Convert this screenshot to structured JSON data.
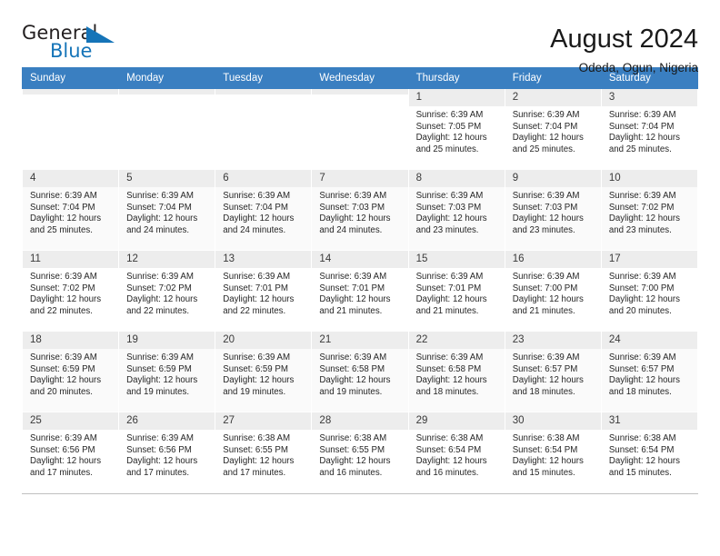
{
  "brand": {
    "name_top": "General",
    "name_bottom": "Blue",
    "accent_color": "#1574b8"
  },
  "header": {
    "title": "August 2024",
    "subtitle": "Odeda, Ogun, Nigeria"
  },
  "theme": {
    "header_bg": "#3a7fc1",
    "header_text": "#ffffff",
    "daynum_bg": "#ededed",
    "row_shade": "#fafafa"
  },
  "weekdays": [
    "Sunday",
    "Monday",
    "Tuesday",
    "Wednesday",
    "Thursday",
    "Friday",
    "Saturday"
  ],
  "labels": {
    "sunrise_prefix": "Sunrise:",
    "sunset_prefix": "Sunset:",
    "daylight_prefix": "Daylight:"
  },
  "weeks": [
    [
      {
        "day": "",
        "lines": []
      },
      {
        "day": "",
        "lines": []
      },
      {
        "day": "",
        "lines": []
      },
      {
        "day": "",
        "lines": []
      },
      {
        "day": "1",
        "lines": [
          "Sunrise: 6:39 AM",
          "Sunset: 7:05 PM",
          "Daylight: 12 hours",
          "and 25 minutes."
        ]
      },
      {
        "day": "2",
        "lines": [
          "Sunrise: 6:39 AM",
          "Sunset: 7:04 PM",
          "Daylight: 12 hours",
          "and 25 minutes."
        ]
      },
      {
        "day": "3",
        "lines": [
          "Sunrise: 6:39 AM",
          "Sunset: 7:04 PM",
          "Daylight: 12 hours",
          "and 25 minutes."
        ]
      }
    ],
    [
      {
        "day": "4",
        "lines": [
          "Sunrise: 6:39 AM",
          "Sunset: 7:04 PM",
          "Daylight: 12 hours",
          "and 25 minutes."
        ]
      },
      {
        "day": "5",
        "lines": [
          "Sunrise: 6:39 AM",
          "Sunset: 7:04 PM",
          "Daylight: 12 hours",
          "and 24 minutes."
        ]
      },
      {
        "day": "6",
        "lines": [
          "Sunrise: 6:39 AM",
          "Sunset: 7:04 PM",
          "Daylight: 12 hours",
          "and 24 minutes."
        ]
      },
      {
        "day": "7",
        "lines": [
          "Sunrise: 6:39 AM",
          "Sunset: 7:03 PM",
          "Daylight: 12 hours",
          "and 24 minutes."
        ]
      },
      {
        "day": "8",
        "lines": [
          "Sunrise: 6:39 AM",
          "Sunset: 7:03 PM",
          "Daylight: 12 hours",
          "and 23 minutes."
        ]
      },
      {
        "day": "9",
        "lines": [
          "Sunrise: 6:39 AM",
          "Sunset: 7:03 PM",
          "Daylight: 12 hours",
          "and 23 minutes."
        ]
      },
      {
        "day": "10",
        "lines": [
          "Sunrise: 6:39 AM",
          "Sunset: 7:02 PM",
          "Daylight: 12 hours",
          "and 23 minutes."
        ]
      }
    ],
    [
      {
        "day": "11",
        "lines": [
          "Sunrise: 6:39 AM",
          "Sunset: 7:02 PM",
          "Daylight: 12 hours",
          "and 22 minutes."
        ]
      },
      {
        "day": "12",
        "lines": [
          "Sunrise: 6:39 AM",
          "Sunset: 7:02 PM",
          "Daylight: 12 hours",
          "and 22 minutes."
        ]
      },
      {
        "day": "13",
        "lines": [
          "Sunrise: 6:39 AM",
          "Sunset: 7:01 PM",
          "Daylight: 12 hours",
          "and 22 minutes."
        ]
      },
      {
        "day": "14",
        "lines": [
          "Sunrise: 6:39 AM",
          "Sunset: 7:01 PM",
          "Daylight: 12 hours",
          "and 21 minutes."
        ]
      },
      {
        "day": "15",
        "lines": [
          "Sunrise: 6:39 AM",
          "Sunset: 7:01 PM",
          "Daylight: 12 hours",
          "and 21 minutes."
        ]
      },
      {
        "day": "16",
        "lines": [
          "Sunrise: 6:39 AM",
          "Sunset: 7:00 PM",
          "Daylight: 12 hours",
          "and 21 minutes."
        ]
      },
      {
        "day": "17",
        "lines": [
          "Sunrise: 6:39 AM",
          "Sunset: 7:00 PM",
          "Daylight: 12 hours",
          "and 20 minutes."
        ]
      }
    ],
    [
      {
        "day": "18",
        "lines": [
          "Sunrise: 6:39 AM",
          "Sunset: 6:59 PM",
          "Daylight: 12 hours",
          "and 20 minutes."
        ]
      },
      {
        "day": "19",
        "lines": [
          "Sunrise: 6:39 AM",
          "Sunset: 6:59 PM",
          "Daylight: 12 hours",
          "and 19 minutes."
        ]
      },
      {
        "day": "20",
        "lines": [
          "Sunrise: 6:39 AM",
          "Sunset: 6:59 PM",
          "Daylight: 12 hours",
          "and 19 minutes."
        ]
      },
      {
        "day": "21",
        "lines": [
          "Sunrise: 6:39 AM",
          "Sunset: 6:58 PM",
          "Daylight: 12 hours",
          "and 19 minutes."
        ]
      },
      {
        "day": "22",
        "lines": [
          "Sunrise: 6:39 AM",
          "Sunset: 6:58 PM",
          "Daylight: 12 hours",
          "and 18 minutes."
        ]
      },
      {
        "day": "23",
        "lines": [
          "Sunrise: 6:39 AM",
          "Sunset: 6:57 PM",
          "Daylight: 12 hours",
          "and 18 minutes."
        ]
      },
      {
        "day": "24",
        "lines": [
          "Sunrise: 6:39 AM",
          "Sunset: 6:57 PM",
          "Daylight: 12 hours",
          "and 18 minutes."
        ]
      }
    ],
    [
      {
        "day": "25",
        "lines": [
          "Sunrise: 6:39 AM",
          "Sunset: 6:56 PM",
          "Daylight: 12 hours",
          "and 17 minutes."
        ]
      },
      {
        "day": "26",
        "lines": [
          "Sunrise: 6:39 AM",
          "Sunset: 6:56 PM",
          "Daylight: 12 hours",
          "and 17 minutes."
        ]
      },
      {
        "day": "27",
        "lines": [
          "Sunrise: 6:38 AM",
          "Sunset: 6:55 PM",
          "Daylight: 12 hours",
          "and 17 minutes."
        ]
      },
      {
        "day": "28",
        "lines": [
          "Sunrise: 6:38 AM",
          "Sunset: 6:55 PM",
          "Daylight: 12 hours",
          "and 16 minutes."
        ]
      },
      {
        "day": "29",
        "lines": [
          "Sunrise: 6:38 AM",
          "Sunset: 6:54 PM",
          "Daylight: 12 hours",
          "and 16 minutes."
        ]
      },
      {
        "day": "30",
        "lines": [
          "Sunrise: 6:38 AM",
          "Sunset: 6:54 PM",
          "Daylight: 12 hours",
          "and 15 minutes."
        ]
      },
      {
        "day": "31",
        "lines": [
          "Sunrise: 6:38 AM",
          "Sunset: 6:54 PM",
          "Daylight: 12 hours",
          "and 15 minutes."
        ]
      }
    ]
  ]
}
